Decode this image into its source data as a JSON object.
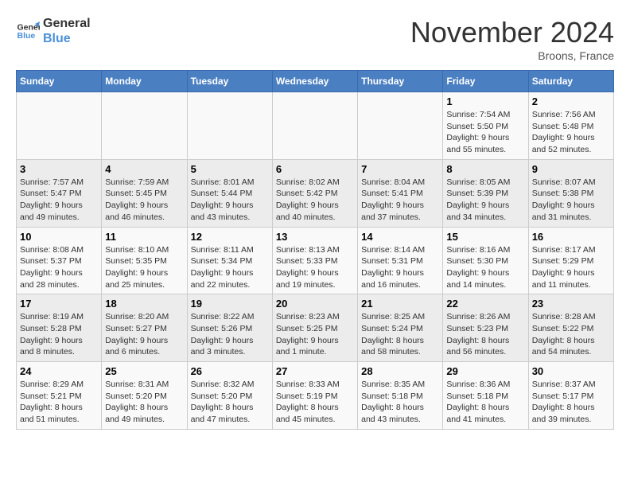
{
  "header": {
    "logo_line1": "General",
    "logo_line2": "Blue",
    "month_title": "November 2024",
    "location": "Broons, France"
  },
  "weekdays": [
    "Sunday",
    "Monday",
    "Tuesday",
    "Wednesday",
    "Thursday",
    "Friday",
    "Saturday"
  ],
  "weeks": [
    [
      {
        "day": "",
        "info": ""
      },
      {
        "day": "",
        "info": ""
      },
      {
        "day": "",
        "info": ""
      },
      {
        "day": "",
        "info": ""
      },
      {
        "day": "",
        "info": ""
      },
      {
        "day": "1",
        "info": "Sunrise: 7:54 AM\nSunset: 5:50 PM\nDaylight: 9 hours and 55 minutes."
      },
      {
        "day": "2",
        "info": "Sunrise: 7:56 AM\nSunset: 5:48 PM\nDaylight: 9 hours and 52 minutes."
      }
    ],
    [
      {
        "day": "3",
        "info": "Sunrise: 7:57 AM\nSunset: 5:47 PM\nDaylight: 9 hours and 49 minutes."
      },
      {
        "day": "4",
        "info": "Sunrise: 7:59 AM\nSunset: 5:45 PM\nDaylight: 9 hours and 46 minutes."
      },
      {
        "day": "5",
        "info": "Sunrise: 8:01 AM\nSunset: 5:44 PM\nDaylight: 9 hours and 43 minutes."
      },
      {
        "day": "6",
        "info": "Sunrise: 8:02 AM\nSunset: 5:42 PM\nDaylight: 9 hours and 40 minutes."
      },
      {
        "day": "7",
        "info": "Sunrise: 8:04 AM\nSunset: 5:41 PM\nDaylight: 9 hours and 37 minutes."
      },
      {
        "day": "8",
        "info": "Sunrise: 8:05 AM\nSunset: 5:39 PM\nDaylight: 9 hours and 34 minutes."
      },
      {
        "day": "9",
        "info": "Sunrise: 8:07 AM\nSunset: 5:38 PM\nDaylight: 9 hours and 31 minutes."
      }
    ],
    [
      {
        "day": "10",
        "info": "Sunrise: 8:08 AM\nSunset: 5:37 PM\nDaylight: 9 hours and 28 minutes."
      },
      {
        "day": "11",
        "info": "Sunrise: 8:10 AM\nSunset: 5:35 PM\nDaylight: 9 hours and 25 minutes."
      },
      {
        "day": "12",
        "info": "Sunrise: 8:11 AM\nSunset: 5:34 PM\nDaylight: 9 hours and 22 minutes."
      },
      {
        "day": "13",
        "info": "Sunrise: 8:13 AM\nSunset: 5:33 PM\nDaylight: 9 hours and 19 minutes."
      },
      {
        "day": "14",
        "info": "Sunrise: 8:14 AM\nSunset: 5:31 PM\nDaylight: 9 hours and 16 minutes."
      },
      {
        "day": "15",
        "info": "Sunrise: 8:16 AM\nSunset: 5:30 PM\nDaylight: 9 hours and 14 minutes."
      },
      {
        "day": "16",
        "info": "Sunrise: 8:17 AM\nSunset: 5:29 PM\nDaylight: 9 hours and 11 minutes."
      }
    ],
    [
      {
        "day": "17",
        "info": "Sunrise: 8:19 AM\nSunset: 5:28 PM\nDaylight: 9 hours and 8 minutes."
      },
      {
        "day": "18",
        "info": "Sunrise: 8:20 AM\nSunset: 5:27 PM\nDaylight: 9 hours and 6 minutes."
      },
      {
        "day": "19",
        "info": "Sunrise: 8:22 AM\nSunset: 5:26 PM\nDaylight: 9 hours and 3 minutes."
      },
      {
        "day": "20",
        "info": "Sunrise: 8:23 AM\nSunset: 5:25 PM\nDaylight: 9 hours and 1 minute."
      },
      {
        "day": "21",
        "info": "Sunrise: 8:25 AM\nSunset: 5:24 PM\nDaylight: 8 hours and 58 minutes."
      },
      {
        "day": "22",
        "info": "Sunrise: 8:26 AM\nSunset: 5:23 PM\nDaylight: 8 hours and 56 minutes."
      },
      {
        "day": "23",
        "info": "Sunrise: 8:28 AM\nSunset: 5:22 PM\nDaylight: 8 hours and 54 minutes."
      }
    ],
    [
      {
        "day": "24",
        "info": "Sunrise: 8:29 AM\nSunset: 5:21 PM\nDaylight: 8 hours and 51 minutes."
      },
      {
        "day": "25",
        "info": "Sunrise: 8:31 AM\nSunset: 5:20 PM\nDaylight: 8 hours and 49 minutes."
      },
      {
        "day": "26",
        "info": "Sunrise: 8:32 AM\nSunset: 5:20 PM\nDaylight: 8 hours and 47 minutes."
      },
      {
        "day": "27",
        "info": "Sunrise: 8:33 AM\nSunset: 5:19 PM\nDaylight: 8 hours and 45 minutes."
      },
      {
        "day": "28",
        "info": "Sunrise: 8:35 AM\nSunset: 5:18 PM\nDaylight: 8 hours and 43 minutes."
      },
      {
        "day": "29",
        "info": "Sunrise: 8:36 AM\nSunset: 5:18 PM\nDaylight: 8 hours and 41 minutes."
      },
      {
        "day": "30",
        "info": "Sunrise: 8:37 AM\nSunset: 5:17 PM\nDaylight: 8 hours and 39 minutes."
      }
    ]
  ]
}
